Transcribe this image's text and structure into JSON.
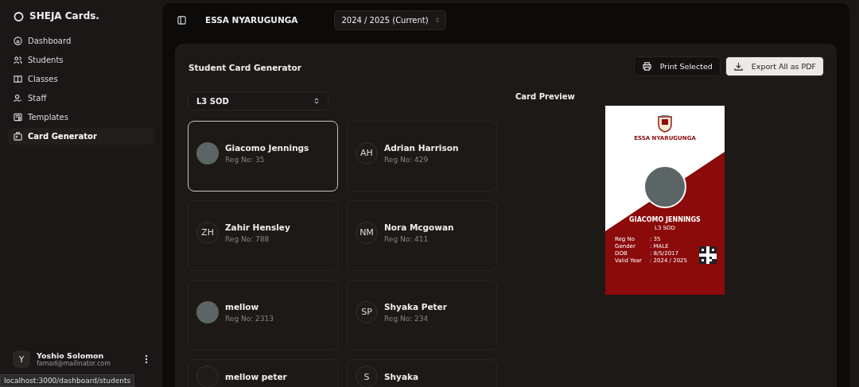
{
  "sidebar": {
    "brand": "SHEJA Cards.",
    "items": [
      {
        "label": "Dashboard",
        "selected": false
      },
      {
        "label": "Students",
        "selected": false
      },
      {
        "label": "Classes",
        "selected": false
      },
      {
        "label": "Staff",
        "selected": false
      },
      {
        "label": "Templates",
        "selected": false
      },
      {
        "label": "Card Generator",
        "selected": true
      }
    ],
    "user": {
      "initial": "Y",
      "name": "Yoshio Solomon",
      "email": "famad@mailinator.com"
    }
  },
  "status_url": "localhost:3000/dashboard/students",
  "header": {
    "school": "ESSA NYARUGUNGA",
    "year": "2024 / 2025 (Current)"
  },
  "panel": {
    "title": "Student Card Generator",
    "class_select": "L3 SOD",
    "buttons": [
      {
        "label": "Print Selected",
        "kind": "print"
      },
      {
        "label": "Export All as PDF",
        "kind": "export"
      }
    ],
    "students": [
      {
        "name": "Giacomo Jennings",
        "reg": "Reg No: 35",
        "kind": "photo",
        "selected": true
      },
      {
        "name": "Adrian Harrison",
        "reg": "Reg No: 429",
        "kind": "initials",
        "initials": "AH",
        "selected": false
      },
      {
        "name": "Zahir Hensley",
        "reg": "Reg No: 788",
        "kind": "initials",
        "initials": "ZH",
        "selected": false
      },
      {
        "name": "Nora Mcgowan",
        "reg": "Reg No: 411",
        "kind": "initials",
        "initials": "NM",
        "selected": false
      },
      {
        "name": "mellow",
        "reg": "Reg No: 2313",
        "kind": "photo",
        "selected": false
      },
      {
        "name": "Shyaka Peter",
        "reg": "Reg No: 234",
        "kind": "initials",
        "initials": "SP",
        "selected": false
      },
      {
        "name": "mellow peter",
        "kind": "initials",
        "selected": false
      },
      {
        "name": "Shyaka",
        "kind": "initials",
        "initials": "S",
        "selected": false
      }
    ],
    "preview": {
      "title": "Card Preview",
      "school": "ESSA NYARUGUNGA",
      "name": "GIACOMO JENNINGS",
      "class": "L3 SOD",
      "fields": [
        {
          "label": "Reg No",
          "value": ": 35"
        },
        {
          "label": "Gender",
          "value": ": MALE"
        },
        {
          "label": "DOB",
          "value": ": 8/5/2017"
        },
        {
          "label": "Valid Year",
          "value": ": 2024 / 2025"
        }
      ]
    }
  }
}
